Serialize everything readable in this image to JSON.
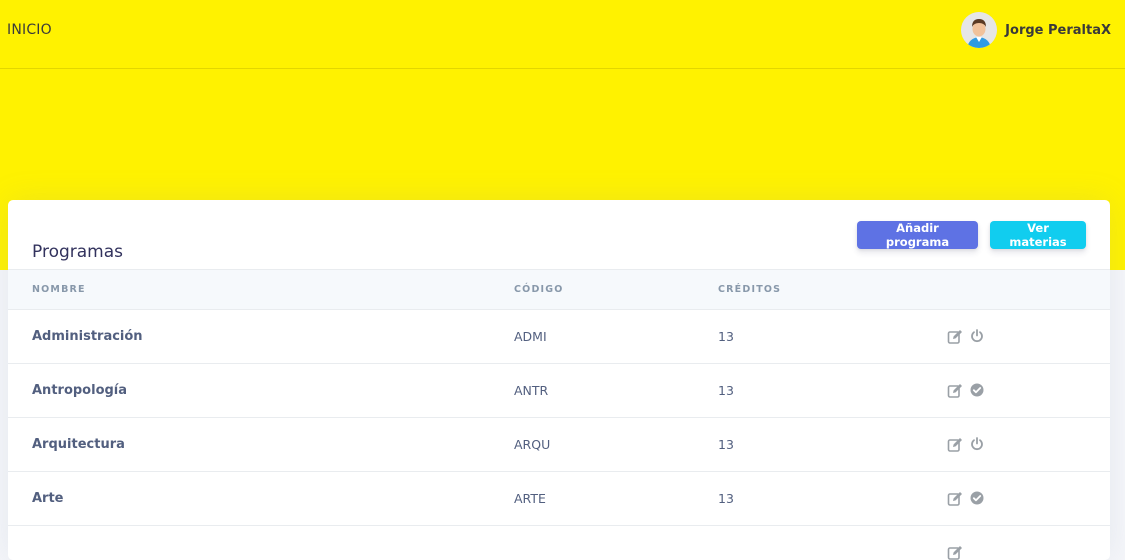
{
  "navbar": {
    "brand": "INICIO",
    "user_name": "Jorge PeraltaX",
    "avatar_icon": "avatar-icon"
  },
  "card": {
    "title": "Programas",
    "add_button": "Añadir programa",
    "view_button": "Ver materias"
  },
  "table": {
    "headers": [
      "NOMBRE",
      "CÓDIGO",
      "CRÉDITOS",
      ""
    ],
    "rows": [
      {
        "nombre": "Administración",
        "codigo": "ADMI",
        "creditos": "13",
        "status_icon": "power-icon"
      },
      {
        "nombre": "Antropología",
        "codigo": "ANTR",
        "creditos": "13",
        "status_icon": "check-circle-icon"
      },
      {
        "nombre": "Arquitectura",
        "codigo": "ARQU",
        "creditos": "13",
        "status_icon": "power-icon"
      },
      {
        "nombre": "Arte",
        "codigo": "ARTE",
        "creditos": "13",
        "status_icon": "check-circle-icon"
      },
      {
        "nombre": "",
        "codigo": "",
        "creditos": "",
        "status_icon": ""
      }
    ]
  },
  "colors": {
    "header_bg": "#fff200",
    "primary": "#5e72e4",
    "info": "#11cdef",
    "icon_gray": "#9aa0a6"
  }
}
